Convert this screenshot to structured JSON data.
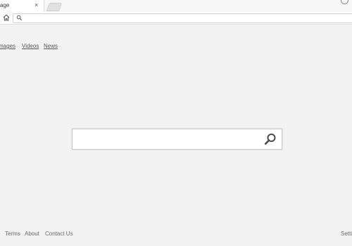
{
  "browser": {
    "tab_title": "age",
    "tab_close": "×"
  },
  "nav": {
    "images": "mages",
    "videos": "Videos",
    "news": "News"
  },
  "search": {
    "placeholder": ""
  },
  "footer": {
    "terms": "Terms",
    "about": "About",
    "contact": "Contact Us",
    "settings": "Setti"
  },
  "icons": {
    "home": "home-icon",
    "omnibox_search": "search-icon",
    "search_button": "magnifier-icon",
    "profile": "profile-icon"
  }
}
